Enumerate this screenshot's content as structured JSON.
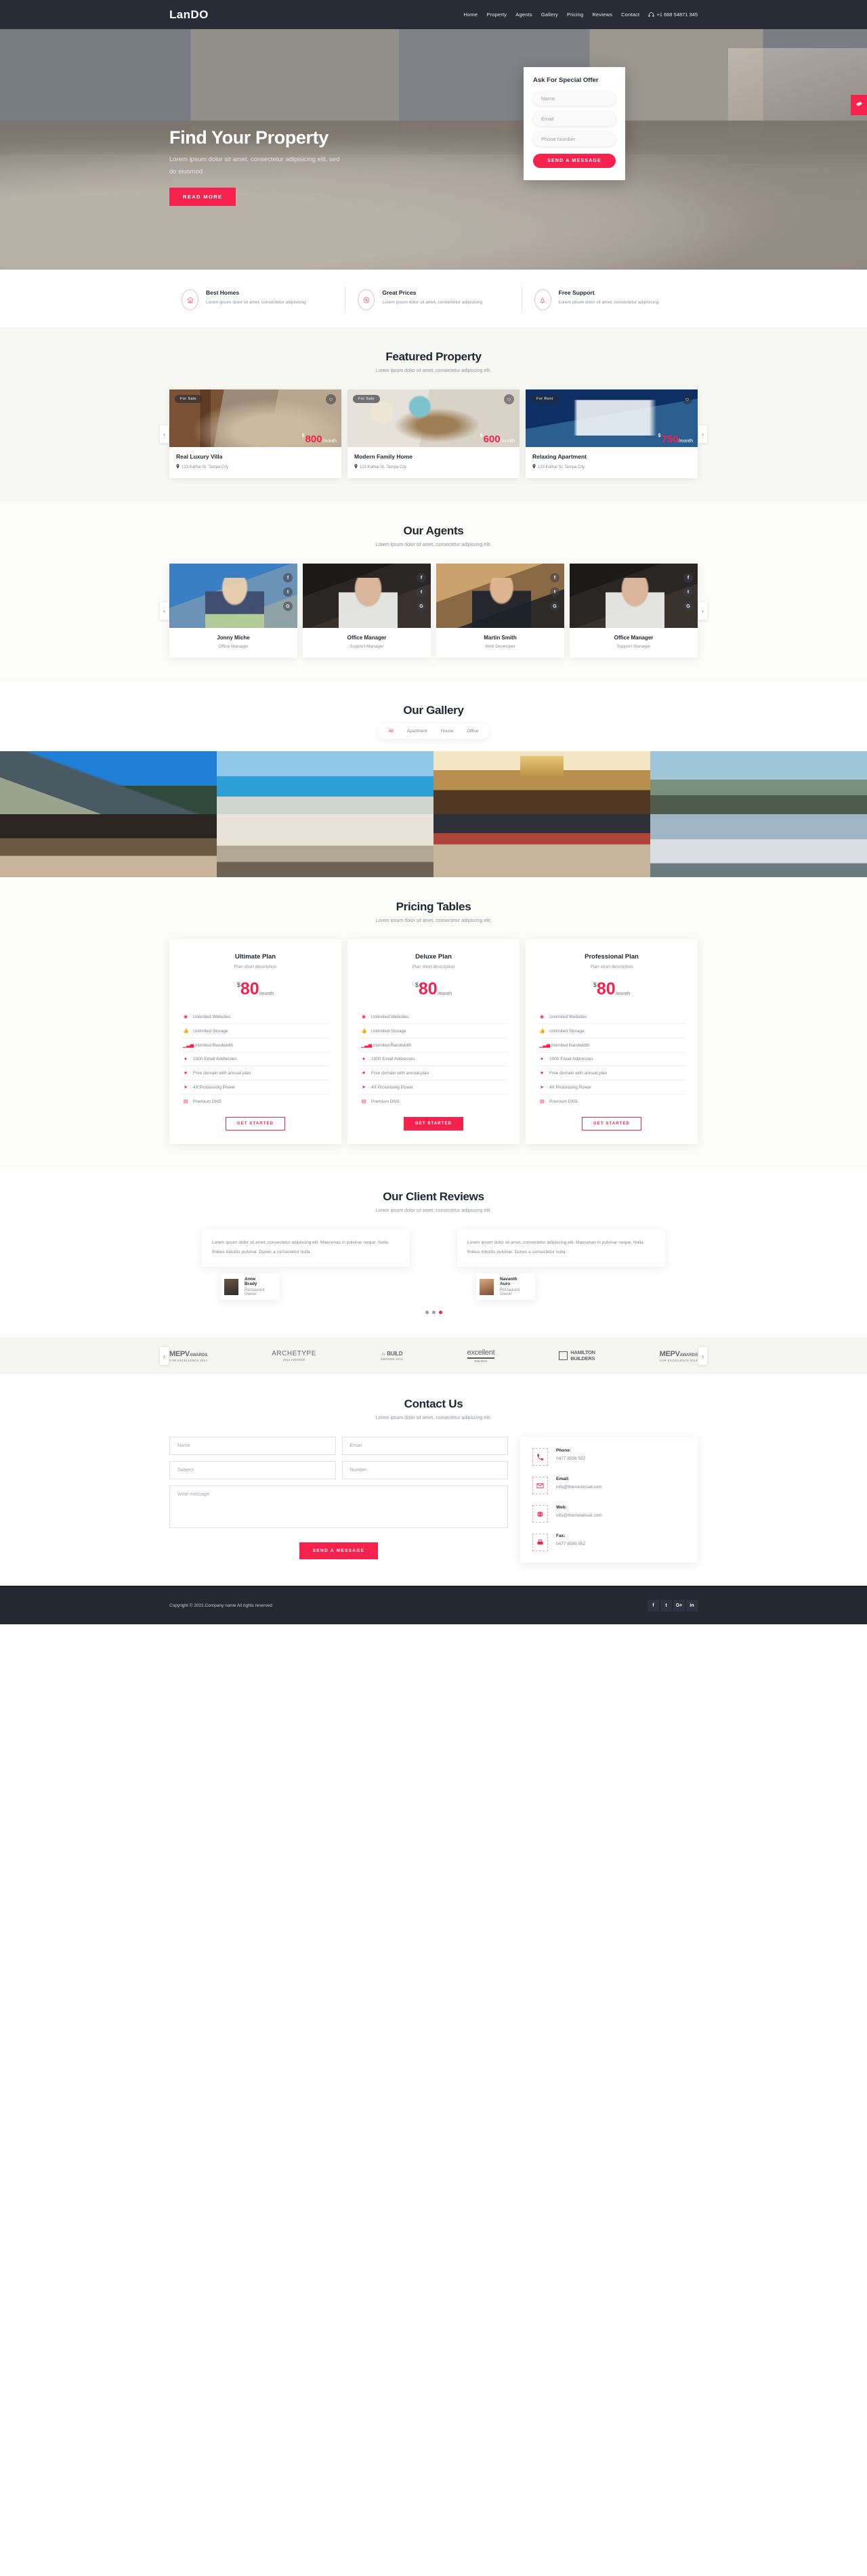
{
  "header": {
    "brand": "LanDO",
    "nav": [
      "Home",
      "Property",
      "Agents",
      "Gallery",
      "Pricing",
      "Reviews",
      "Contact"
    ],
    "phone": "+1 668 54871 345",
    "phone_icon": "headset-icon"
  },
  "hero": {
    "title": "Find Your Property",
    "subtitle": "Lorem ipsum dolor sit amet, consectetur adipisicing elit, sed do eiusmod",
    "cta": "READ MORE",
    "offer": {
      "title": "Ask For Special Offer",
      "name_placeholder": "Name",
      "name_value": "",
      "email_placeholder": "Email",
      "email_value": "",
      "phone_placeholder": "Phone Number",
      "phone_value": "",
      "submit": "SEND A MESSAGE"
    },
    "side_tab_icon": "gear-icon"
  },
  "features": [
    {
      "icon": "home-icon",
      "title": "Best Homes",
      "desc": "Lorem ipsum dolor sit amet, consectetur adipisicing"
    },
    {
      "icon": "percent-badge-icon",
      "title": "Great Prices",
      "desc": "Lorem ipsum dolor sit amet, consectetur adipisicing"
    },
    {
      "icon": "support-bell-icon",
      "title": "Free Support",
      "desc": "Lorem ipsum dolor sit amet, consectetur adipisicing"
    }
  ],
  "featured": {
    "title": "Featured Property",
    "subtitle": "Lorem ipsum dolor sit amet, consectetur adipiscing elit.",
    "items": [
      {
        "badge": "For Sale",
        "currency": "$",
        "amount": "800",
        "per": "/month",
        "name": "Real Luxury Villa",
        "address": "123 Kathal St. Tampa City"
      },
      {
        "badge": "For Sale",
        "currency": "$",
        "amount": "600",
        "per": "/month",
        "name": "Modern Family Home",
        "address": "123 Kathal St. Tampa City"
      },
      {
        "badge": "For Rent",
        "currency": "$",
        "amount": "750",
        "per": "/month",
        "name": "Relaxing Apartment",
        "address": "123 Kathal St. Tampa City"
      }
    ]
  },
  "agents": {
    "title": "Our Agents",
    "subtitle": "Lorem ipsum dolor sit amet, consectetur adipiscing elit.",
    "socials": [
      "f",
      "t",
      "G"
    ],
    "items": [
      {
        "name": "Jonny Miche",
        "role": "Office Manager"
      },
      {
        "name": "Office Manager",
        "role": "Support Manager"
      },
      {
        "name": "Martin Smith",
        "role": "Web Developer"
      },
      {
        "name": "Office Manager",
        "role": "Support Manager"
      }
    ]
  },
  "gallery": {
    "title": "Our Gallery",
    "tabs": [
      "All",
      "Apartment",
      "House",
      "Office"
    ],
    "active_tab": "All",
    "cells": 8
  },
  "pricing": {
    "title": "Pricing Tables",
    "subtitle": "Lorem ipsum dolor sit amet, consectetur adipiscing elit.",
    "plans": [
      {
        "name": "Ultimate Plan",
        "desc": "Plan short description",
        "currency": "$",
        "amount": "80",
        "per": "/month",
        "features": [
          {
            "icon": "globe-icon",
            "label": "Unlimited Websites"
          },
          {
            "icon": "thumbs-up-icon",
            "label": "Unlimited Storage"
          },
          {
            "icon": "bar-chart-icon",
            "label": "Unlimited Bandwidth"
          },
          {
            "icon": "user-icon",
            "label": "1000 Email Addresses"
          },
          {
            "icon": "star-icon",
            "label": "Free domain with annual plan"
          },
          {
            "icon": "rocket-icon",
            "label": "4X Processing Power"
          },
          {
            "icon": "list-icon",
            "label": "Premium DNS"
          }
        ],
        "cta": "GET STARTED",
        "highlight": false
      },
      {
        "name": "Deluxe Plan",
        "desc": "Plan short description",
        "currency": "$",
        "amount": "80",
        "per": "/month",
        "features": [
          {
            "icon": "globe-icon",
            "label": "Unlimited Websites"
          },
          {
            "icon": "thumbs-up-icon",
            "label": "Unlimited Storage"
          },
          {
            "icon": "bar-chart-icon",
            "label": "Unlimited Bandwidth"
          },
          {
            "icon": "user-icon",
            "label": "1000 Email Addresses"
          },
          {
            "icon": "star-icon",
            "label": "Free domain with annual plan"
          },
          {
            "icon": "rocket-icon",
            "label": "4X Processing Power"
          },
          {
            "icon": "list-icon",
            "label": "Premium DNS"
          }
        ],
        "cta": "GET STARTED",
        "highlight": true
      },
      {
        "name": "Professional Plan",
        "desc": "Plan short description",
        "currency": "$",
        "amount": "80",
        "per": "/month",
        "features": [
          {
            "icon": "globe-icon",
            "label": "Unlimited Websites"
          },
          {
            "icon": "thumbs-up-icon",
            "label": "Unlimited Storage"
          },
          {
            "icon": "bar-chart-icon",
            "label": "Unlimited Bandwidth"
          },
          {
            "icon": "user-icon",
            "label": "1000 Email Addresses"
          },
          {
            "icon": "star-icon",
            "label": "Free domain with annual plan"
          },
          {
            "icon": "rocket-icon",
            "label": "4X Processing Power"
          },
          {
            "icon": "list-icon",
            "label": "Premium DNS"
          }
        ],
        "cta": "GET STARTED",
        "highlight": false
      }
    ]
  },
  "reviews": {
    "title": "Our Client Reviews",
    "subtitle": "Lorem ipsum dolor sit amet, consectetur adipiscing elit.",
    "items": [
      {
        "text": "Lorem ipsum dolor sit amet, consectetur adipiscing elit. Maecenas in pulvinar neque. Nulla finibus lobortis pulvinar. Donec a consectetur nulla.",
        "name": "Anne Brady",
        "role": "Restaurant Owner"
      },
      {
        "text": "Lorem ipsum dolor sit amet, consectetur adipiscing elit. Maecenas in pulvinar neque. Nulla finibus lobortis pulvinar. Donec a consectetur nulla.",
        "name": "Navanth Auro",
        "role": "Restaurant Owner"
      }
    ],
    "dots": 3,
    "active_dot": 2
  },
  "clients": [
    {
      "name": "MEPV",
      "suffix": "AWARDS",
      "tagline": "FOR EXCELLENCE 2014"
    },
    {
      "name": "ARCHETYPE",
      "suffix": "",
      "tagline": "2014 AWARDS"
    },
    {
      "name": "BUILD",
      "suffix": "",
      "tagline": "AWARDS 2014"
    },
    {
      "name": "excellent",
      "suffix": "",
      "tagline": "WINNER"
    },
    {
      "name": "HAMILTON",
      "suffix": "",
      "tagline": "BUILDERS"
    },
    {
      "name": "MEPV",
      "suffix": "AWARDS",
      "tagline": "FOR EXCELLENCE 2014"
    }
  ],
  "contact": {
    "title": "Contact Us",
    "subtitle": "Lorem ipsum dolor sit amet, consectetur adipiscing elit.",
    "name_placeholder": "Name",
    "name_value": "",
    "email_placeholder": "Email",
    "email_value": "",
    "subject_placeholder": "Subject",
    "subject_value": "",
    "number_placeholder": "Number",
    "number_value": "",
    "message_placeholder": "Write message",
    "message_value": "",
    "submit": "SEND A MESSAGE",
    "info": [
      {
        "icon": "phone-icon",
        "label": "Phone:",
        "value": "0477 8556 552"
      },
      {
        "icon": "envelope-icon",
        "label": "Email:",
        "value": "info@themevessel.com"
      },
      {
        "icon": "globe-icon",
        "label": "Web:",
        "value": "info@themevessel.com"
      },
      {
        "icon": "fax-icon",
        "label": "Fax:",
        "value": "0477 8556 552"
      }
    ]
  },
  "footer": {
    "copyright": "Copyright © 2021.Company name All rights reserved",
    "socials": [
      "f",
      "t",
      "G+",
      "in"
    ]
  },
  "colors": {
    "accent": "#f5224e",
    "dark": "#272c37",
    "light": "#f7f7f4"
  },
  "carousel_arrows": {
    "prev": "‹",
    "next": "›"
  }
}
